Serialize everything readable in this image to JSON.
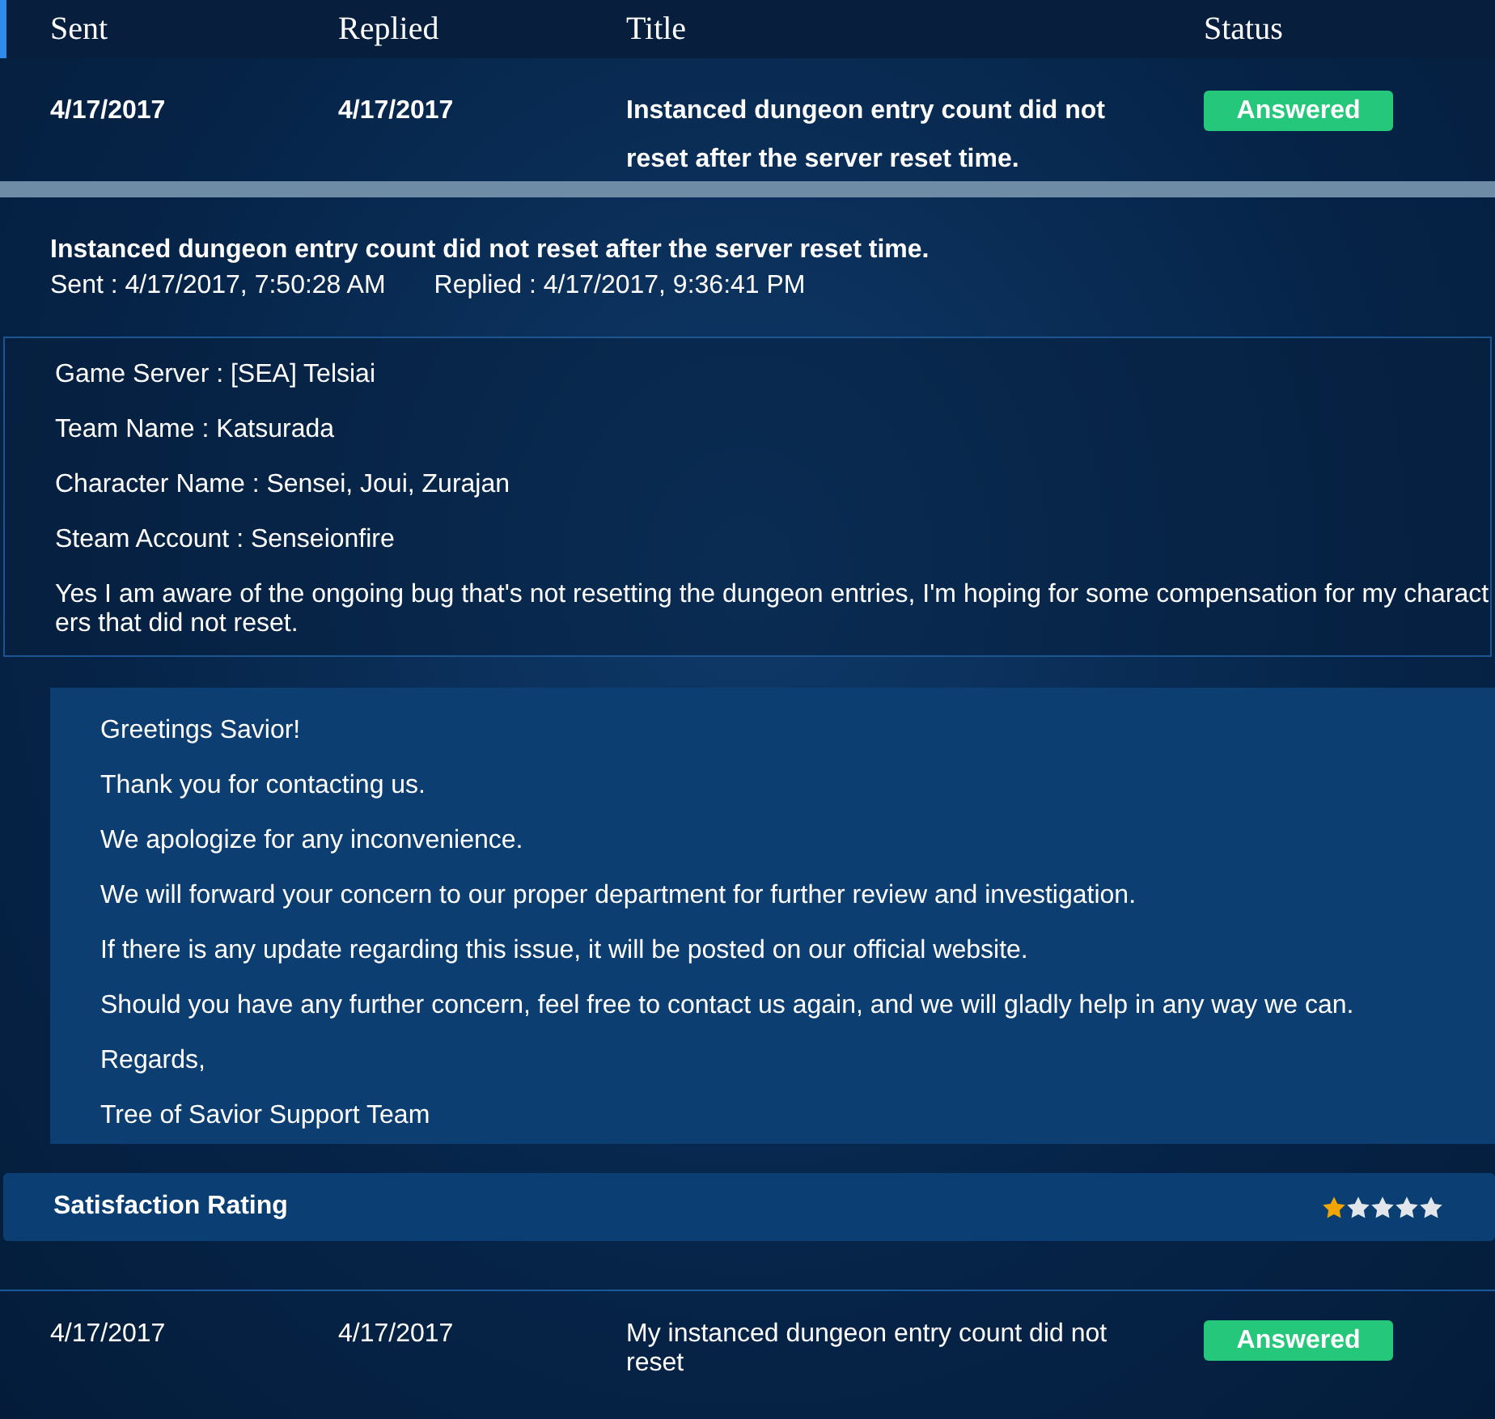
{
  "table": {
    "columns": [
      "Sent",
      "Replied",
      "Title",
      "Status"
    ],
    "rows": [
      {
        "sent": "4/17/2017",
        "replied": "4/17/2017",
        "title": "Instanced dungeon entry count did not reset after the server reset time.",
        "status": "Answered",
        "expanded": true
      },
      {
        "sent": "4/17/2017",
        "replied": "4/17/2017",
        "title": "My instanced dungeon entry count did not reset",
        "status": "Answered",
        "expanded": false
      }
    ]
  },
  "detail": {
    "title": "Instanced dungeon entry count did not reset after the server reset time.",
    "sent": "Sent : 4/17/2017, 7:50:28 AM",
    "replied": "Replied : 4/17/2017, 9:36:41 PM",
    "question": [
      "Game Server : [SEA] Telsiai",
      "Team Name : Katsurada",
      "Character Name : Sensei, Joui, Zurajan",
      "Steam Account : Senseionfire",
      "Yes I am aware of the ongoing bug that's not resetting the dungeon entries, I'm hoping for some compensation for my characters that did not reset."
    ],
    "answer": [
      "Greetings Savior!",
      "Thank you for contacting us.",
      "We apologize for any inconvenience.",
      "We will forward your concern to our proper department for further review and investigation.",
      "If there is any update regarding this issue, it will be posted on our official website.",
      "Should you have any further concern, feel free to contact us again, and we will gladly help in any way we can.",
      "Regards,",
      "Tree of Savior Support Team"
    ],
    "rating": {
      "label": "Satisfaction Rating",
      "stars": 1
    }
  }
}
